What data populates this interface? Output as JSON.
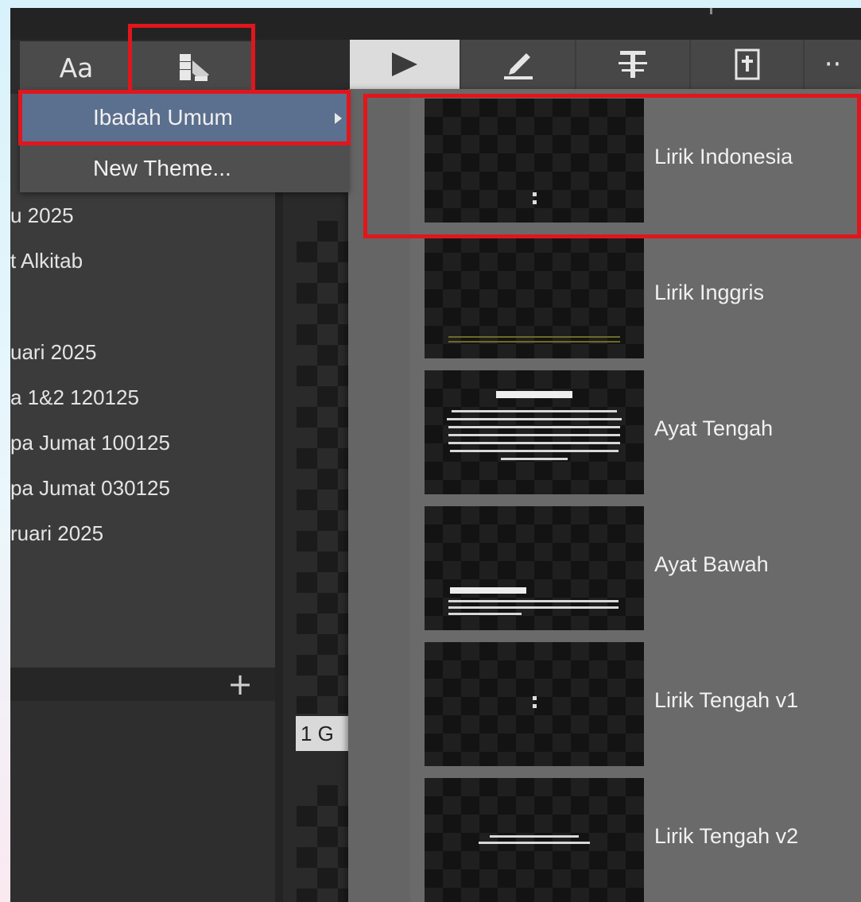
{
  "left_tabs": {
    "text_tab_label": "Aa",
    "themes_tab_icon": "theme-palette-icon"
  },
  "menu": {
    "items": [
      {
        "label": "Ibadah Umum",
        "has_submenu": true
      },
      {
        "label": "New Theme..."
      }
    ]
  },
  "documents": [
    "u 2025",
    "t Alkitab",
    "uari 2025",
    "a 1&2 120125",
    "pa Jumat 100125",
    "pa Jumat 030125",
    "ruari 2025"
  ],
  "panel": {
    "add_label": "+"
  },
  "slide": {
    "label": "1  G"
  },
  "right_tabs": [
    "play-icon",
    "pencil-icon",
    "text-format-icon",
    "bible-icon",
    "more-icon"
  ],
  "right_more_label": "··",
  "themes": [
    {
      "name": "Lirik Indonesia"
    },
    {
      "name": "Lirik Inggris"
    },
    {
      "name": "Ayat Tengah"
    },
    {
      "name": "Ayat Bawah"
    },
    {
      "name": "Lirik Tengah v1"
    },
    {
      "name": "Lirik Tengah v2"
    }
  ],
  "colors": {
    "highlight": "#e0161c",
    "menu_selected": "#5b6f8e"
  }
}
